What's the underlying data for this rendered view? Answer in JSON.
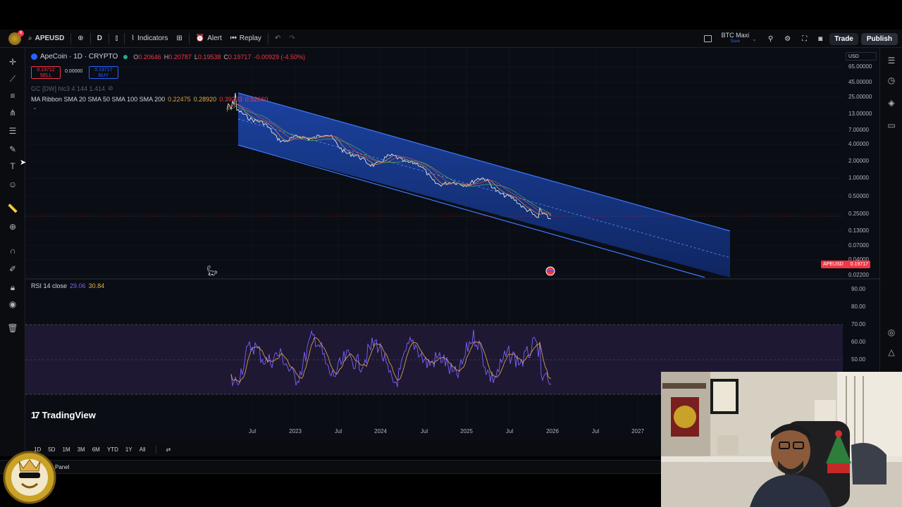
{
  "toolbar": {
    "symbol": "APEUSD",
    "interval": "D",
    "indicators_label": "Indicators",
    "alert_label": "Alert",
    "replay_label": "Replay",
    "layout_name": "BTC Maxi",
    "layout_sub": "Save",
    "trade_label": "Trade",
    "publish_label": "Publish",
    "notification_count": "8"
  },
  "legend": {
    "title": "ApeCoin · 1D · CRYPTO",
    "ohlc": [
      {
        "k": "O",
        "v": "0.20646"
      },
      {
        "k": "H",
        "v": "0.20787"
      },
      {
        "k": "L",
        "v": "0.19538"
      },
      {
        "k": "C",
        "v": "0.19717"
      }
    ],
    "change": "-0.00929 (-4.50%)",
    "sell_price": "0.19712",
    "sell_label": "SELL",
    "buy_price": "0.19717",
    "buy_label": "BUY",
    "spread": "0.00000",
    "indicator_gc": "GC [DW] hlc3 4 144 1.414",
    "ma_ribbon_label": "MA Ribbon SMA 20 SMA 50 SMA 100 SMA 200",
    "ma_values": [
      "0.22475",
      "0.28920",
      "0.39203",
      "0.52660"
    ],
    "rsi_label": "RSI 14 close",
    "rsi_values": [
      "29.06",
      "30.84"
    ]
  },
  "price_axis": {
    "currency": "USD",
    "labels": [
      "65.00000",
      "45.00000",
      "25.00000",
      "13.00000",
      "7.00000",
      "4.00000",
      "2.00000",
      "1.00000",
      "0.50000",
      "0.25000",
      "0.13000",
      "0.07000",
      "0.04000",
      "0.02200"
    ],
    "current_symbol": "APEUSD",
    "current_price": "0.19717"
  },
  "rsi_axis": {
    "labels": [
      "90.00",
      "80.00",
      "70.00",
      "60.00",
      "50.00"
    ]
  },
  "time_axis": {
    "labels": [
      "Jul",
      "2023",
      "Jul",
      "2024",
      "Jul",
      "2025",
      "Jul",
      "2026",
      "Jul",
      "2027"
    ]
  },
  "timeframes": [
    "1D",
    "5D",
    "1M",
    "3M",
    "6M",
    "YTD",
    "1Y",
    "All"
  ],
  "panel_label": "Panel",
  "brand": "TradingView",
  "colors": {
    "channel_fill": "#1c3f99",
    "channel_line": "#2f6bff",
    "rsi_line_a": "#7b61ff",
    "rsi_line_b": "#e0b04a",
    "sell": "#f23645",
    "buy": "#2962ff"
  }
}
